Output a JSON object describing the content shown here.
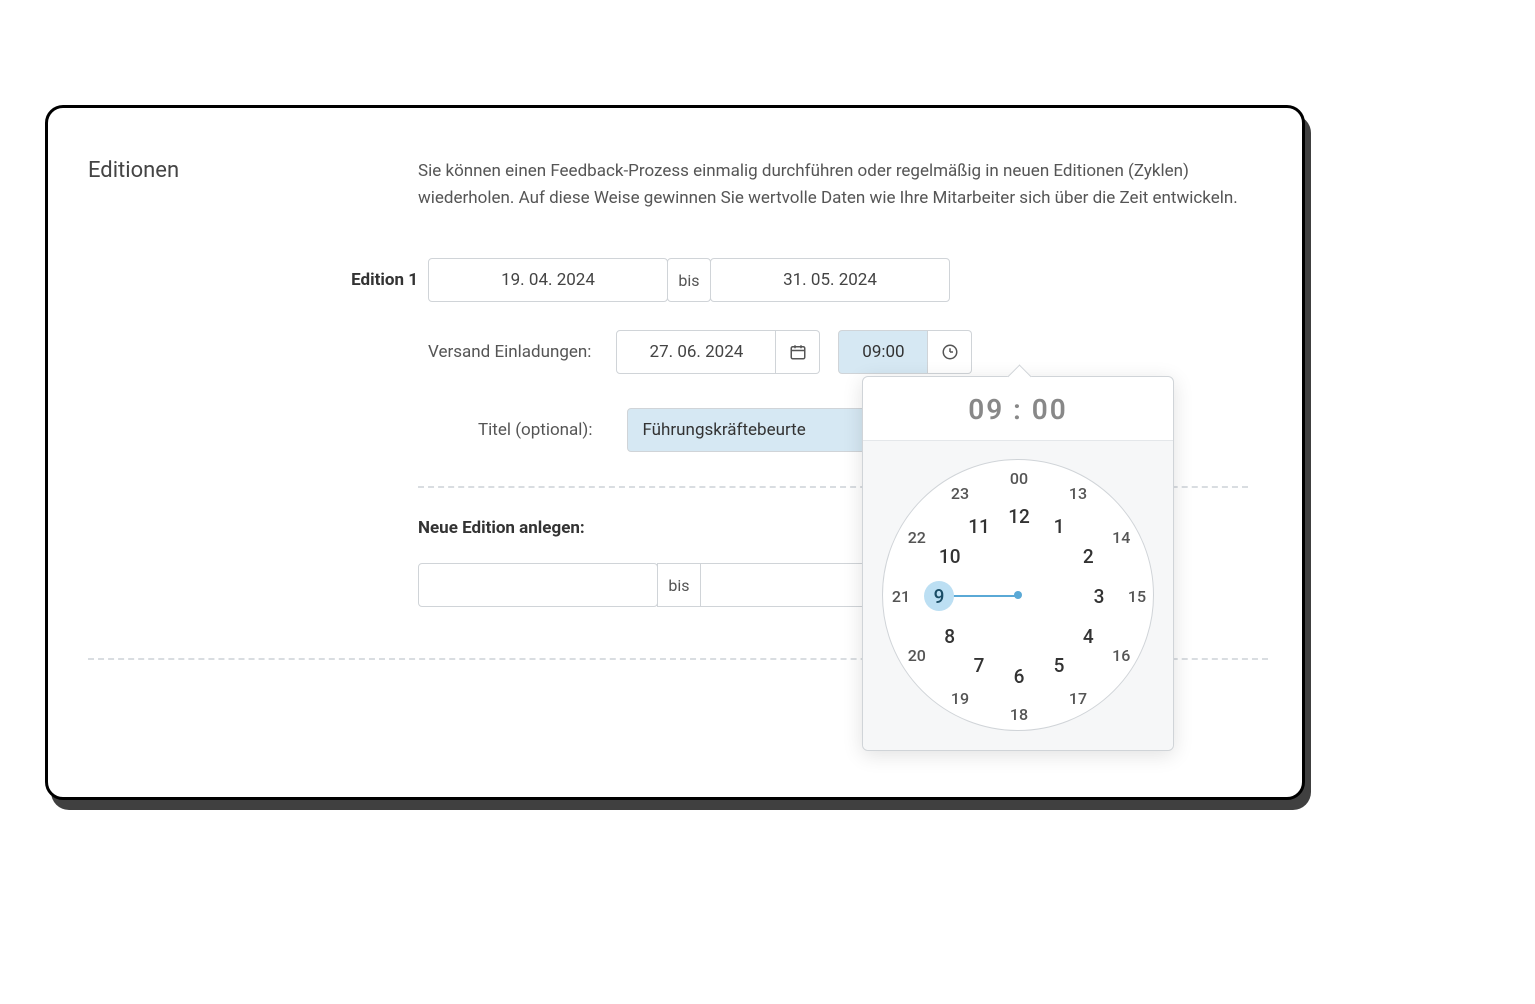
{
  "section_title": "Editionen",
  "description": "Sie können einen Feedback-Prozess einmalig durchführen oder regelmäßig in neuen Editionen (Zyklen) wiederholen. Auf diese Weise gewinnen Sie wertvolle Daten wie Ihre Mitarbeiter sich über die Zeit entwickeln.",
  "edition1": {
    "label": "Edition 1",
    "from_date": "19. 04. 2024",
    "to_label": "bis",
    "to_date": "31. 05. 2024"
  },
  "versand": {
    "label": "Versand Einladungen:",
    "date": "27. 06. 2024",
    "time": "09:00"
  },
  "titel": {
    "label": "Titel (optional):",
    "value": "Führungskräftebeurte"
  },
  "neue": {
    "label": "Neue Edition anlegen:",
    "to_label": "bis"
  },
  "timepicker": {
    "display": "09 : 00",
    "selected_hour": 9,
    "inner_hours": [
      "12",
      "1",
      "2",
      "3",
      "4",
      "5",
      "6",
      "7",
      "8",
      "9",
      "10",
      "11"
    ],
    "outer_hours": [
      "00",
      "13",
      "14",
      "15",
      "16",
      "17",
      "18",
      "19",
      "20",
      "21",
      "22",
      "23"
    ]
  }
}
